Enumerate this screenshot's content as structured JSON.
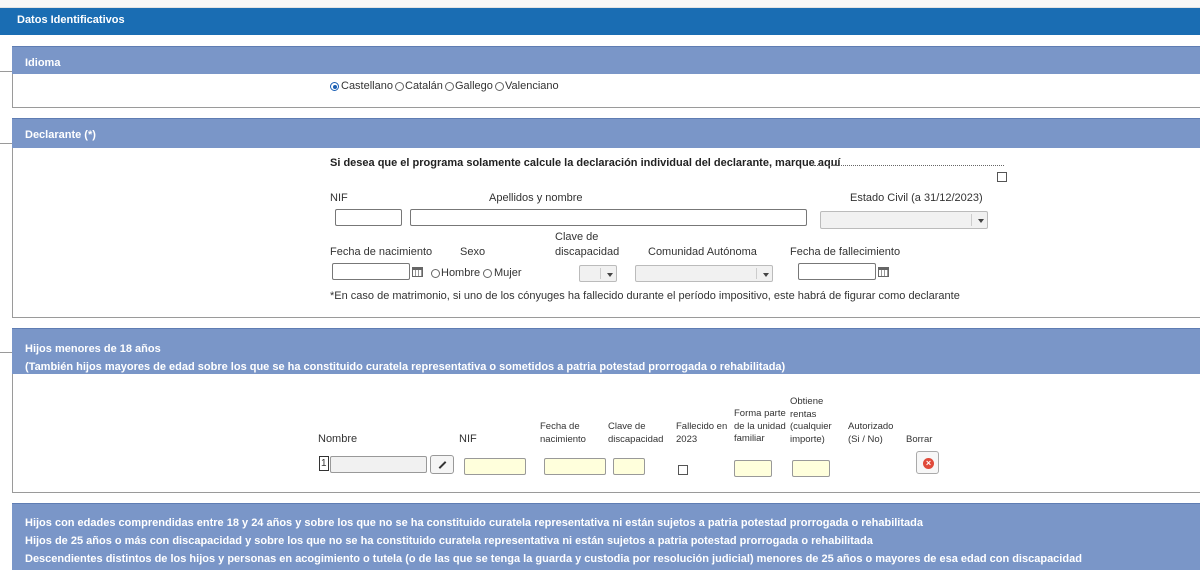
{
  "main": {
    "title": "Datos Identificativos"
  },
  "idioma": {
    "title": "Idioma",
    "options": [
      "Castellano",
      "Catalán",
      "Gallego",
      "Valenciano"
    ],
    "selected": "Castellano"
  },
  "declarante": {
    "title": "Declarante (*)",
    "individual_label": "Si desea que el programa solamente calcule la declaración individual del declarante, marque aquí",
    "nif_label": "NIF",
    "nombre_label": "Apellidos y nombre",
    "estado_civil_label": "Estado Civil (a 31/12/2023)",
    "fecha_nac_label": "Fecha de nacimiento",
    "sexo_label": "Sexo",
    "sexo_options": [
      "Hombre",
      "Mujer"
    ],
    "discapacidad_label_1": "Clave de",
    "discapacidad_label_2": "discapacidad",
    "comunidad_label": "Comunidad Autónoma",
    "fallecimiento_label": "Fecha de fallecimiento",
    "note": "*En caso de matrimonio, si uno de los cónyuges ha fallecido durante el período impositivo, este habrá de figurar como declarante"
  },
  "hijos": {
    "title_1": "Hijos menores de 18 años",
    "title_2": "(También hijos mayores de edad sobre los que se ha constituido curatela representativa o sometidos a patria potestad prorrogada o rehabilitada)",
    "col_nombre": "Nombre",
    "col_nif": "NIF",
    "col_fecha_1": "Fecha de",
    "col_fecha_2": "nacimiento",
    "col_clave_1": "Clave de",
    "col_clave_2": "discapacidad",
    "col_fallecido_1": "Fallecido en",
    "col_fallecido_2": "2023",
    "col_forma_1": "Forma parte",
    "col_forma_2": "de la unidad",
    "col_forma_3": "familiar",
    "col_rentas_1": "Obtiene",
    "col_rentas_2": "rentas",
    "col_rentas_3": "(cualquier",
    "col_rentas_4": "importe)",
    "col_autorizado_1": "Autorizado",
    "col_autorizado_2": "(Si / No)",
    "col_borrar": "Borrar",
    "row_number": "1",
    "delete_glyph": "×"
  },
  "otros": {
    "line_1": "Hijos con edades comprendidas entre 18 y 24 años y sobre los que no se ha constituido curatela representativa ni están sujetos a patria potestad prorrogada o rehabilitada",
    "line_2": "Hijos de 25 años o más con discapacidad y sobre los que no se ha constituido curatela representativa ni están sujetos a patria potestad prorrogada o rehabilitada",
    "line_3": "Descendientes distintos de los hijos y personas en acogimiento o tutela (o de las que se tenga la guarda y custodia por resolución judicial) menores de 25 años o mayores de esa edad con discapacidad"
  },
  "colors": {
    "header": "#1a6db3",
    "section": "#7a96c8",
    "yellow_field": "#ffffdc"
  }
}
